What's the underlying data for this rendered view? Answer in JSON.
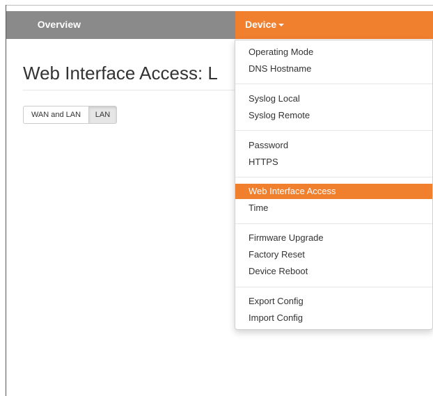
{
  "nav": {
    "overview_label": "Overview",
    "device_label": "Device",
    "accent_color": "#f07f2e",
    "bar_color": "#8a8a8a"
  },
  "main": {
    "title": "Web Interface Access: L",
    "toggle": {
      "options": [
        "WAN and LAN",
        "LAN"
      ],
      "selected": "LAN"
    }
  },
  "device_menu": {
    "groups": [
      [
        "Operating Mode",
        "DNS Hostname"
      ],
      [
        "Syslog Local",
        "Syslog Remote"
      ],
      [
        "Password",
        "HTTPS"
      ],
      [
        "Web Interface Access",
        "Time"
      ],
      [
        "Firmware Upgrade",
        "Factory Reset",
        "Device Reboot"
      ],
      [
        "Export Config",
        "Import Config"
      ]
    ],
    "active_item": "Web Interface Access"
  }
}
